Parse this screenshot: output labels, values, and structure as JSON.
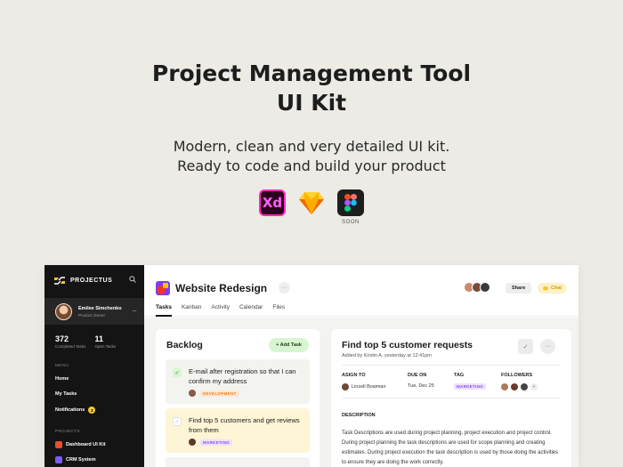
{
  "hero": {
    "title_line1": "Project Management Tool",
    "title_line2": "UI Kit",
    "subtitle_line1": "Modern, clean and very detailed UI kit.",
    "subtitle_line2": "Ready to code and build your product",
    "tools": [
      {
        "name": "Adobe XD",
        "label": "Xd",
        "icon": "xd-icon"
      },
      {
        "name": "Sketch",
        "icon": "sketch-icon"
      },
      {
        "name": "Figma",
        "icon": "figma-icon",
        "caption": "SOON"
      }
    ]
  },
  "sidebar": {
    "brand": "PROJECTUS",
    "user": {
      "name": "Emilee Simchenko",
      "role": "Product Owner"
    },
    "stats": [
      {
        "value": "372",
        "label": "Completed Tasks"
      },
      {
        "value": "11",
        "label": "Open Tasks"
      }
    ],
    "menu_label": "MENU",
    "menu": [
      {
        "label": "Home"
      },
      {
        "label": "My Tasks"
      },
      {
        "label": "Notifications",
        "badge": "3"
      }
    ],
    "projects_label": "PROJECTS",
    "projects": [
      {
        "label": "Dashboard UI Kit",
        "color": "#e94f2e"
      },
      {
        "label": "CRM System",
        "color": "#7b5cf5"
      }
    ]
  },
  "header": {
    "title": "Website Redesign",
    "more": "···",
    "tabs": [
      "Tasks",
      "Kanban",
      "Activity",
      "Calendar",
      "Files"
    ],
    "active_tab": "Tasks",
    "share_label": "Share",
    "chat_label": "Chat"
  },
  "backlog": {
    "title": "Backlog",
    "add_label": "+ Add Task",
    "tasks": [
      {
        "text": "E-mail after registration so that I can confirm my address",
        "tag": "DEVELOPMENT",
        "tag_color": "#f0801f",
        "done": true
      },
      {
        "text": "Find top 5 customers and get reviews from them",
        "tag": "MARKETING",
        "tag_color": "#8a4df5",
        "done": false
      }
    ]
  },
  "detail": {
    "title": "Find top 5 customer requests",
    "added": "Added by Kristin A. yesterday at 12:41pm",
    "fields": {
      "assign_label": "ASIGN TO",
      "assignee": "Linzell Bowman",
      "due_label": "DUE ON",
      "due": "Tue, Dec 25",
      "tag_label": "TAG",
      "tag": "MARKETING",
      "followers_label": "FOLLOWERS"
    },
    "description_label": "DESCRIPTION",
    "description": "Task Descriptions are used during project planning, project execution and project control. During project planning the task descriptions are used for scope planning and creating estimates. During project execution the task description is used by those doing the activities to ensure they are doing the work correctly."
  }
}
